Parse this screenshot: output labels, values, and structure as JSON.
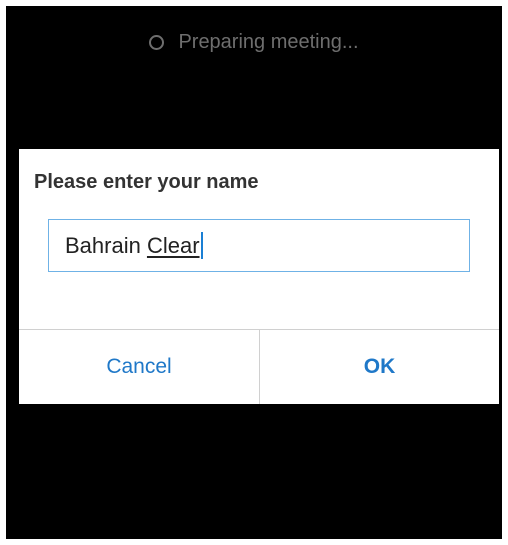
{
  "status": {
    "text": "Preparing meeting..."
  },
  "dialog": {
    "title": "Please enter your name",
    "input": {
      "value_prefix": "Bahrain ",
      "value_composing": "Clear"
    },
    "buttons": {
      "cancel_label": "Cancel",
      "ok_label": "OK"
    }
  },
  "colors": {
    "accent": "#1f78c8",
    "input_border": "#6fb2e6",
    "background": "#000000"
  }
}
